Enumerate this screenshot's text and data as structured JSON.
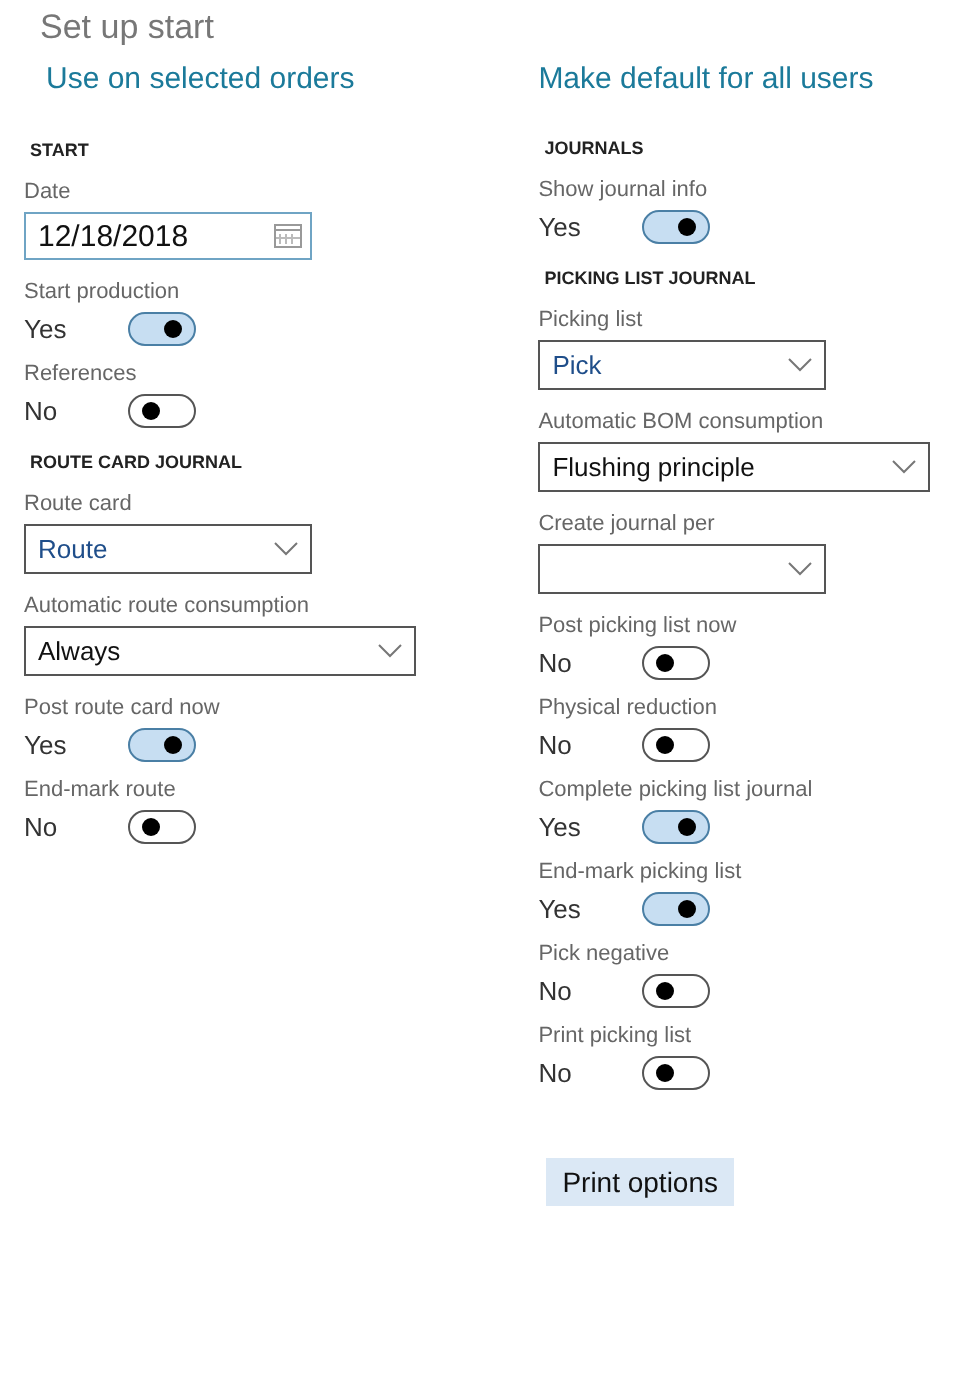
{
  "title": "Set up start",
  "actions": [
    {
      "label": "Use on selected orders"
    },
    {
      "label": "Make default for all users"
    }
  ],
  "columns": [
    {
      "fields": [
        {
          "kind": "heading",
          "label": "START"
        },
        {
          "kind": "date",
          "label": "Date",
          "value": "12/18/2018"
        },
        {
          "kind": "toggle",
          "label": "Start production",
          "value": "Yes",
          "on": true
        },
        {
          "kind": "toggle",
          "label": "References",
          "value": "No",
          "on": false
        },
        {
          "kind": "heading",
          "label": "ROUTE CARD JOURNAL"
        },
        {
          "kind": "lookup",
          "label": "Route card",
          "value": "Route"
        },
        {
          "kind": "select",
          "label": "Automatic route consumption",
          "value": "Always"
        },
        {
          "kind": "toggle",
          "label": "Post route card now",
          "value": "Yes",
          "on": true
        },
        {
          "kind": "toggle",
          "label": "End-mark route",
          "value": "No",
          "on": false
        }
      ]
    },
    {
      "fields": [
        {
          "kind": "heading",
          "label": "JOURNALS"
        },
        {
          "kind": "toggle",
          "label": "Show journal info",
          "value": "Yes",
          "on": true
        },
        {
          "kind": "heading",
          "label": "PICKING LIST JOURNAL"
        },
        {
          "kind": "lookup",
          "label": "Picking list",
          "value": "Pick"
        },
        {
          "kind": "select",
          "label": "Automatic BOM consumption",
          "value": "Flushing principle"
        },
        {
          "kind": "lookup",
          "label": "Create journal per"
        },
        {
          "kind": "toggle",
          "label": "Post picking list now",
          "value": "No",
          "on": false
        },
        {
          "kind": "toggle",
          "label": "Physical reduction",
          "value": "No",
          "on": false
        },
        {
          "kind": "toggle",
          "label": "Complete picking list journal",
          "value": "Yes",
          "on": true
        },
        {
          "kind": "toggle",
          "label": "End-mark picking list",
          "value": "Yes",
          "on": true
        },
        {
          "kind": "toggle",
          "label": "Pick negative",
          "value": "No",
          "on": false
        },
        {
          "kind": "toggle",
          "label": "Print picking list",
          "value": "No",
          "on": false
        },
        {
          "kind": "button",
          "label": "Print options"
        }
      ]
    }
  ]
}
